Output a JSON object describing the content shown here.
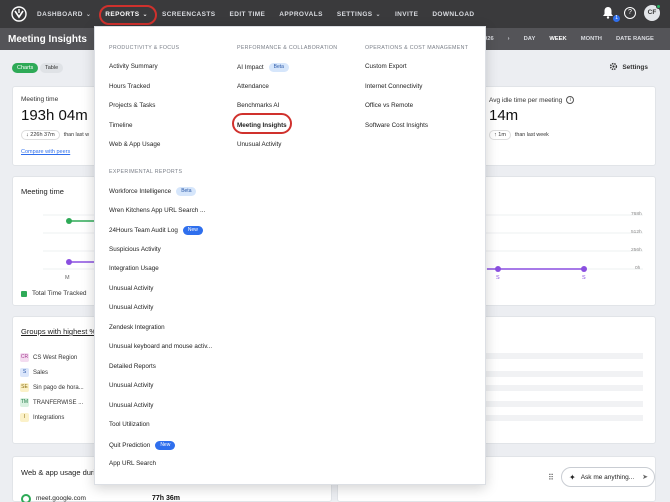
{
  "nav": {
    "items": [
      "DASHBOARD",
      "REPORTS",
      "SCREENCASTS",
      "EDIT TIME",
      "APPROVALS",
      "SETTINGS",
      "INVITE",
      "DOWNLOAD"
    ],
    "notification_count": "1",
    "help": "?",
    "avatar_initials": "CF"
  },
  "subheader": {
    "title": "Meeting Insights",
    "partial": "A",
    "date_partial": "026",
    "prev_arrow": "‹",
    "next_arrow": "›",
    "ranges": [
      "DAY",
      "WEEK",
      "MONTH",
      "DATE RANGE"
    ],
    "active_range": "WEEK"
  },
  "toolbar": {
    "charts": "Charts",
    "table": "Table",
    "settings": "Settings"
  },
  "stats": {
    "meeting_time_label": "Meeting time",
    "meeting_time_value": "193h 04m",
    "meeting_time_delta": "226h 37m",
    "meeting_time_delta_suffix": "than last w",
    "compare_link": "Compare with peers",
    "idle_label": "Avg idle time per meeting",
    "idle_value": "14m",
    "idle_delta": "1m",
    "idle_delta_suffix": "than last week"
  },
  "meeting_chart": {
    "title": "Meeting time",
    "xlabel_first": "M",
    "s_labels": [
      "S",
      "S"
    ],
    "y_ticks": [
      "768h",
      "512h",
      "256h",
      "0h"
    ],
    "legend": "Total Time Tracked",
    "colors": {
      "tracked": "#2eaa57",
      "meeting": "#8a4fe0"
    }
  },
  "groups": {
    "title": "Groups with highest %",
    "items": [
      {
        "initials": "CR",
        "name": "CS West Region",
        "bg": "#f4dcf0",
        "fg": "#a33a8f"
      },
      {
        "initials": "S",
        "name": "Sales",
        "bg": "#dbe6fb",
        "fg": "#2b59a8"
      },
      {
        "initials": "SE",
        "name": "Sin pago de hora...",
        "bg": "#fbf1c9",
        "fg": "#8a6d0a"
      },
      {
        "initials": "TM",
        "name": "TRANFERWISE ...",
        "bg": "#d9f1e1",
        "fg": "#1e7a45"
      },
      {
        "initials": "I",
        "name": "Integrations",
        "bg": "#fbf1c9",
        "fg": "#8a6d0a"
      }
    ]
  },
  "usage": {
    "title": "Web & app usage duri",
    "site": "meet.google.com",
    "time": "77h 36m"
  },
  "dropdown": {
    "col1_head": "PRODUCTIVITY & FOCUS",
    "col1": [
      "Activity Summary",
      "Hours Tracked",
      "Projects & Tasks",
      "Timeline",
      "Web & App Usage"
    ],
    "col2_head": "PERFORMANCE & COLLABORATION",
    "col2": [
      "AI Impact",
      "Attendance",
      "Benchmarks AI",
      "Meeting Insights",
      "Unusual Activity"
    ],
    "col3_head": "OPERATIONS & COST MANAGEMENT",
    "col3": [
      "Custom Export",
      "Internet Connectivity",
      "Office vs Remote",
      "Software Cost Insights"
    ],
    "exp_head": "EXPERIMENTAL REPORTS",
    "exp": [
      "Workforce Intelligence",
      "Wren Kitchens App URL Search ...",
      "24Hours Team Audit Log",
      "Suspicious Activity",
      "Integration Usage",
      "Unusual Activity",
      "Unusual Activity",
      "Zendesk Integration",
      "Unusual keyboard and mouse activ...",
      "Detailed Reports",
      "Unusual Activity",
      "Unusual Activity",
      "Tool Utilization",
      "Quit Prediction",
      "App URL Search"
    ],
    "beta": "Beta",
    "new": "New"
  },
  "chat": {
    "placeholder": "Ask me anything..."
  }
}
